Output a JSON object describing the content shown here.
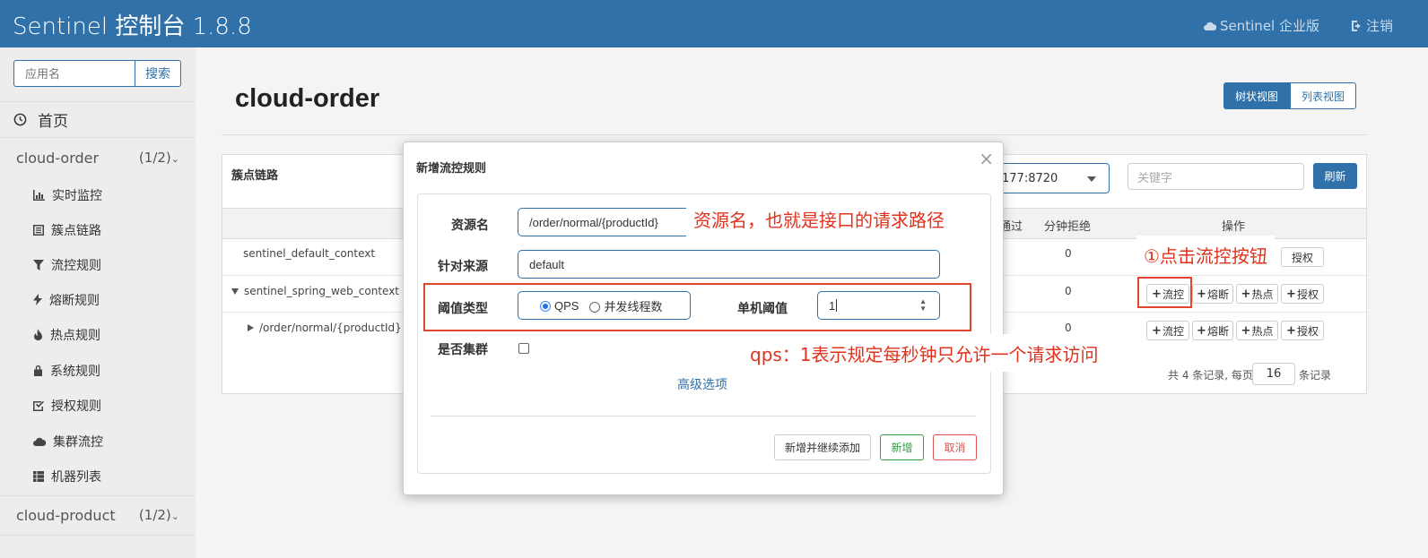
{
  "header": {
    "title": "Sentinel 控制台 1.8.8",
    "enterprise_label": "Sentinel 企业版",
    "logout_label": "注销"
  },
  "sidebar": {
    "search_placeholder": "应用名",
    "search_button": "搜索",
    "home_label": "首页",
    "apps": [
      {
        "name": "cloud-order",
        "count": "(1/2)"
      },
      {
        "name": "cloud-product",
        "count": "(1/2)"
      }
    ],
    "items": [
      {
        "label": "实时监控",
        "icon": "bar-chart-icon"
      },
      {
        "label": "簇点链路",
        "icon": "list-icon"
      },
      {
        "label": "流控规则",
        "icon": "filter-icon"
      },
      {
        "label": "熔断规则",
        "icon": "flash-icon"
      },
      {
        "label": "热点规则",
        "icon": "fire-icon"
      },
      {
        "label": "系统规则",
        "icon": "lock-icon"
      },
      {
        "label": "授权规则",
        "icon": "check-square-icon"
      },
      {
        "label": "集群流控",
        "icon": "cloud-icon"
      },
      {
        "label": "机器列表",
        "icon": "grid-icon"
      }
    ]
  },
  "main": {
    "page_title": "cloud-order",
    "view_tree": "树状视图",
    "view_list": "列表视图",
    "panel_title": "簇点链路",
    "machine_value": "177:8720",
    "keyword_placeholder": "关键字",
    "refresh_button": "刷新",
    "columns": {
      "pass": "通过",
      "reject": "分钟拒绝",
      "actions": "操作"
    },
    "rows": [
      {
        "resource": "sentinel_default_context",
        "reject": "0"
      },
      {
        "resource": "sentinel_spring_web_context",
        "reject": "0"
      },
      {
        "resource": "/order/normal/{productId}",
        "reject": "0"
      }
    ],
    "ops": {
      "flow": "流控",
      "degrade": "熔断",
      "hot": "热点",
      "auth": "授权"
    },
    "pager_prefix": "共 4 条记录, 每页",
    "pager_size": "16",
    "pager_suffix": "条记录"
  },
  "modal": {
    "title": "新增流控规则",
    "close": "×",
    "resource_label": "资源名",
    "resource_value": "/order/normal/{productId}",
    "origin_label": "针对来源",
    "origin_value": "default",
    "grade_label": "阈值类型",
    "grade_options": [
      "QPS",
      "并发线程数"
    ],
    "grade_selected": "QPS",
    "count_label": "单机阈值",
    "count_value": "1",
    "cluster_label": "是否集群",
    "advanced_link": "高级选项",
    "btn_add_continue": "新增并继续添加",
    "btn_add": "新增",
    "btn_cancel": "取消"
  },
  "annotations": {
    "resource_note": "资源名，也就是接口的请求路径",
    "click_note": "①点击流控按钮",
    "qps_note": "qps：1表示规定每秒钟只允许一个请求访问"
  },
  "colors": {
    "primary": "#3071a9",
    "annotation": "#e0321c",
    "success": "#2ea043",
    "danger": "#d9534f"
  }
}
